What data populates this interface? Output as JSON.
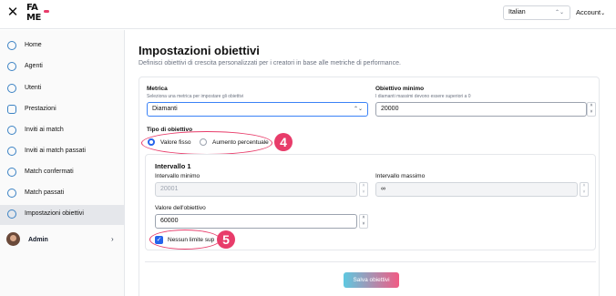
{
  "topbar": {
    "close_icon": "close-icon",
    "logo_line1": "FA",
    "logo_line2": "ME",
    "language": "Italian",
    "account_label": "Account"
  },
  "sidebar": {
    "items": [
      {
        "label": "Home",
        "icon": "home-icon"
      },
      {
        "label": "Agenti",
        "icon": "person-icon"
      },
      {
        "label": "Utenti",
        "icon": "person-icon"
      },
      {
        "label": "Prestazioni",
        "icon": "chart-icon"
      },
      {
        "label": "Inviti ai match",
        "icon": "match-icon"
      },
      {
        "label": "Inviti ai match passati",
        "icon": "match-icon"
      },
      {
        "label": "Match confermati",
        "icon": "match-icon"
      },
      {
        "label": "Match passati",
        "icon": "match-icon"
      },
      {
        "label": "Impostazioni obiettivi",
        "icon": "gear-icon",
        "active": true
      }
    ],
    "admin_label": "Admin"
  },
  "page": {
    "title": "Impostazioni obiettivi",
    "subtitle": "Definisci obiettivi di crescita personalizzati per i creatori in base alle metriche di performance."
  },
  "form": {
    "metric_label": "Metrica",
    "metric_hint": "Seleziona una metrica per impostare gli obiettivi",
    "metric_value": "Diamanti",
    "min_goal_label": "Obiettivo minimo",
    "min_goal_hint": "I diamanti massimi devono essere superiori a 0",
    "min_goal_value": "20000",
    "goal_type_label": "Tipo di obiettivo",
    "goal_type_options": [
      "Valore fisso",
      "Aumento percentuale"
    ],
    "goal_type_selected": "Valore fisso"
  },
  "interval": {
    "title": "Intervallo 1",
    "min_label": "Intervallo minimo",
    "min_value": "20001",
    "max_label": "Intervallo massimo",
    "max_value": "∞",
    "goal_value_label": "Valore dell'obiettivo",
    "goal_value": "60000",
    "no_limit_label": "Nessun limite sup",
    "no_limit_checked": true
  },
  "annotations": {
    "badge_4": "4",
    "badge_5": "5",
    "accent_color": "#e83c6a"
  },
  "actions": {
    "save_label": "Salva obiettivi"
  }
}
